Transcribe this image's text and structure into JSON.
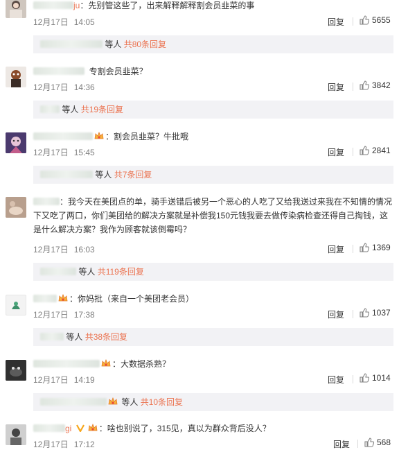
{
  "comments": [
    {
      "text": "：先别管这些了，出来解释解释割会员韭菜的事",
      "name_tail": "ju",
      "date": "12月17日",
      "time": "14:05",
      "reply_label": "回复",
      "likes": "5655",
      "sub_who": "等人",
      "sub_count": "共80条回复"
    },
    {
      "text": "专割会员韭菜？",
      "date": "12月17日",
      "time": "14:36",
      "reply_label": "回复",
      "likes": "3842",
      "sub_who": "等人",
      "sub_count": "共19条回复"
    },
    {
      "text": "：割会员韭菜？牛批哦",
      "date": "12月17日",
      "time": "15:45",
      "reply_label": "回复",
      "likes": "2841",
      "sub_who": "等人",
      "sub_count": "共7条回复"
    },
    {
      "text": "：我今天在美团点的单，骑手送错后被另一个恶心的人吃了又给我送过来我在不知情的情况下又吃了两口，你们美团给的解决方案就是补偿我150元钱我要去做传染病检查还得自己掏钱，这是什么解决方案？我作为顾客就该倒霉吗？",
      "date": "12月17日",
      "time": "16:03",
      "reply_label": "回复",
      "likes": "1369",
      "sub_who": "等人",
      "sub_count": "共119条回复"
    },
    {
      "text": "：你妈批（来自一个美团老会员）",
      "date": "12月17日",
      "time": "17:38",
      "reply_label": "回复",
      "likes": "1037",
      "sub_who": "等人",
      "sub_count": "共38条回复"
    },
    {
      "text": "：大数据杀熟？",
      "date": "12月17日",
      "time": "14:19",
      "reply_label": "回复",
      "likes": "1014",
      "sub_who": "等人",
      "sub_count": "共10条回复"
    },
    {
      "text": "：啥也别说了，315见，真以为群众背后没人？",
      "name_tail": "gi",
      "date": "12月17日",
      "time": "17:12",
      "reply_label": "回复",
      "likes": "568"
    }
  ],
  "colors": {
    "accent": "#eb7350",
    "subbox": "#f2f2f5",
    "muted": "#808080"
  },
  "icons": {
    "like": "thumbs-up-icon",
    "badge": "member-crown-icon",
    "vip": "v-verified-icon"
  }
}
